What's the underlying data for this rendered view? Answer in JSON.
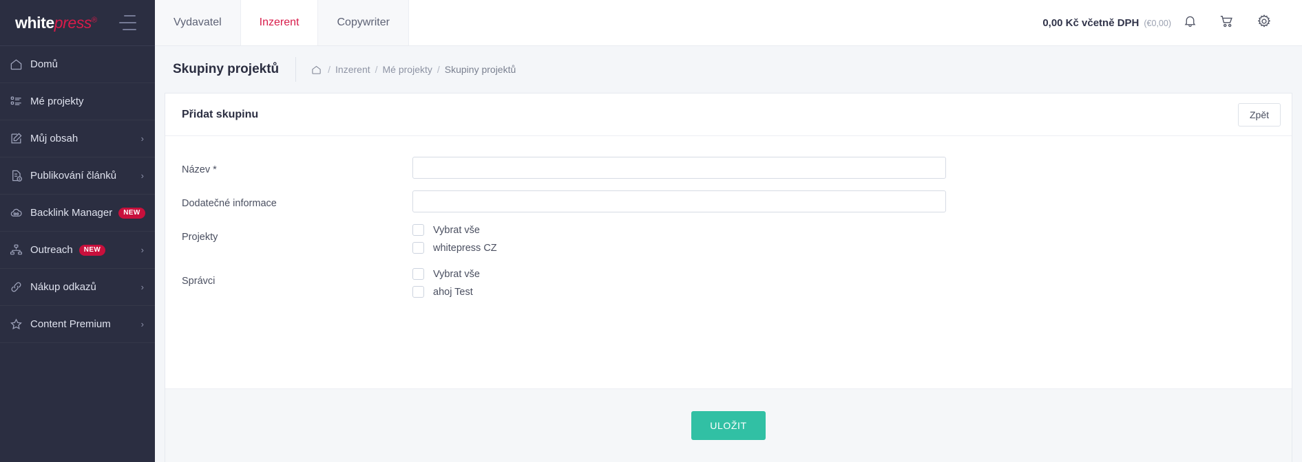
{
  "brand": {
    "name_white": "white",
    "name_accent": "press",
    "registered": "®",
    "accent_color": "#d81b4a"
  },
  "sidebar": {
    "items": [
      {
        "label": "Domů",
        "icon": "home-icon",
        "badge": null,
        "chevron": false
      },
      {
        "label": "Mé projekty",
        "icon": "list-icon",
        "badge": null,
        "chevron": false
      },
      {
        "label": "Můj obsah",
        "icon": "edit-icon",
        "badge": null,
        "chevron": true
      },
      {
        "label": "Publikování článků",
        "icon": "document-dollar-icon",
        "badge": null,
        "chevron": true
      },
      {
        "label": "Backlink Manager",
        "icon": "link-cloud-icon",
        "badge": "NEW",
        "chevron": false
      },
      {
        "label": "Outreach",
        "icon": "network-icon",
        "badge": "NEW",
        "chevron": true
      },
      {
        "label": "Nákup odkazů",
        "icon": "chain-icon",
        "badge": null,
        "chevron": true
      },
      {
        "label": "Content Premium",
        "icon": "star-icon",
        "badge": null,
        "chevron": true
      }
    ],
    "badge_color": "#c8103c"
  },
  "topbar": {
    "tabs": [
      {
        "label": "Vydavatel",
        "active": false
      },
      {
        "label": "Inzerent",
        "active": true
      },
      {
        "label": "Copywriter",
        "active": false
      }
    ],
    "price": "0,00 Kč včetně DPH",
    "price_secondary": "(€0,00)",
    "icons": [
      "bell-icon",
      "cart-icon",
      "gear-icon"
    ]
  },
  "page": {
    "title": "Skupiny projektů",
    "breadcrumb": {
      "home": "home-icon",
      "items": [
        "Inzerent",
        "Mé projekty",
        "Skupiny projektů"
      ],
      "separator": "/"
    }
  },
  "card": {
    "title": "Přidat skupinu",
    "back_label": "Zpět",
    "fields": {
      "name": {
        "label": "Název *",
        "value": "",
        "placeholder": ""
      },
      "additional": {
        "label": "Dodatečné informace",
        "value": "",
        "placeholder": ""
      },
      "projects": {
        "label": "Projekty",
        "options": [
          {
            "label": "Vybrat vše",
            "checked": false
          },
          {
            "label": "whitepress CZ",
            "checked": false
          }
        ]
      },
      "managers": {
        "label": "Správci",
        "options": [
          {
            "label": "Vybrat vše",
            "checked": false
          },
          {
            "label": "ahoj Test",
            "checked": false
          }
        ]
      }
    },
    "save_label": "ULOŽIT",
    "save_color": "#31c0a4"
  }
}
